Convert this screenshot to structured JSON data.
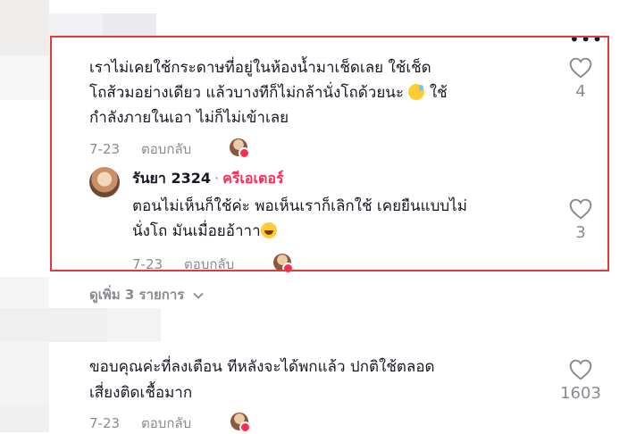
{
  "comment1": {
    "text_line1": "เราไม่เคยใช้กระดาษที่อยู่ในห้องน้ำมาเช็ดเลย ใช้เช็ด",
    "text_line2a": "โถส้วมอย่างเดียว แล้วบางทีก็ไม่กล้านั่งโถด้วยนะ",
    "text_line2b": "ใช้",
    "text_line3": "กำลังภายในเอา ไม่ก็ไม่เข้าเลย",
    "date": "7-23",
    "reply_label": "ตอบกลับ",
    "likes": "4",
    "more_label": "•••"
  },
  "reply1": {
    "author": "รันยา 2324",
    "separator": "·",
    "badge": "ครีเอเตอร์",
    "text_line1": "ตอนไม่เห็นก็ใช้ค่ะ พอเห็นเราก็เลิกใช้ เคยยืนแบบไม่",
    "text_line2": "นั่งโถ มันเมื่อยอ้าาา",
    "date": "7-23",
    "reply_label": "ตอบกลับ",
    "likes": "3"
  },
  "view_more": "ดูเพิ่ม 3 รายการ",
  "comment2": {
    "text_line1": "ขอบคุณค่ะที่ลงเตือน ทีหลังจะได้พกแล้ว ปกติใช้ตลอด",
    "text_line2": "เสี่ยงติดเชื้อมาก",
    "date": "7-23",
    "reply_label": "ตอบกลับ",
    "likes": "1603"
  },
  "colors": {
    "highlight": "#e0393e",
    "creator": "#fe2c55",
    "muted": "#8a8b91"
  }
}
